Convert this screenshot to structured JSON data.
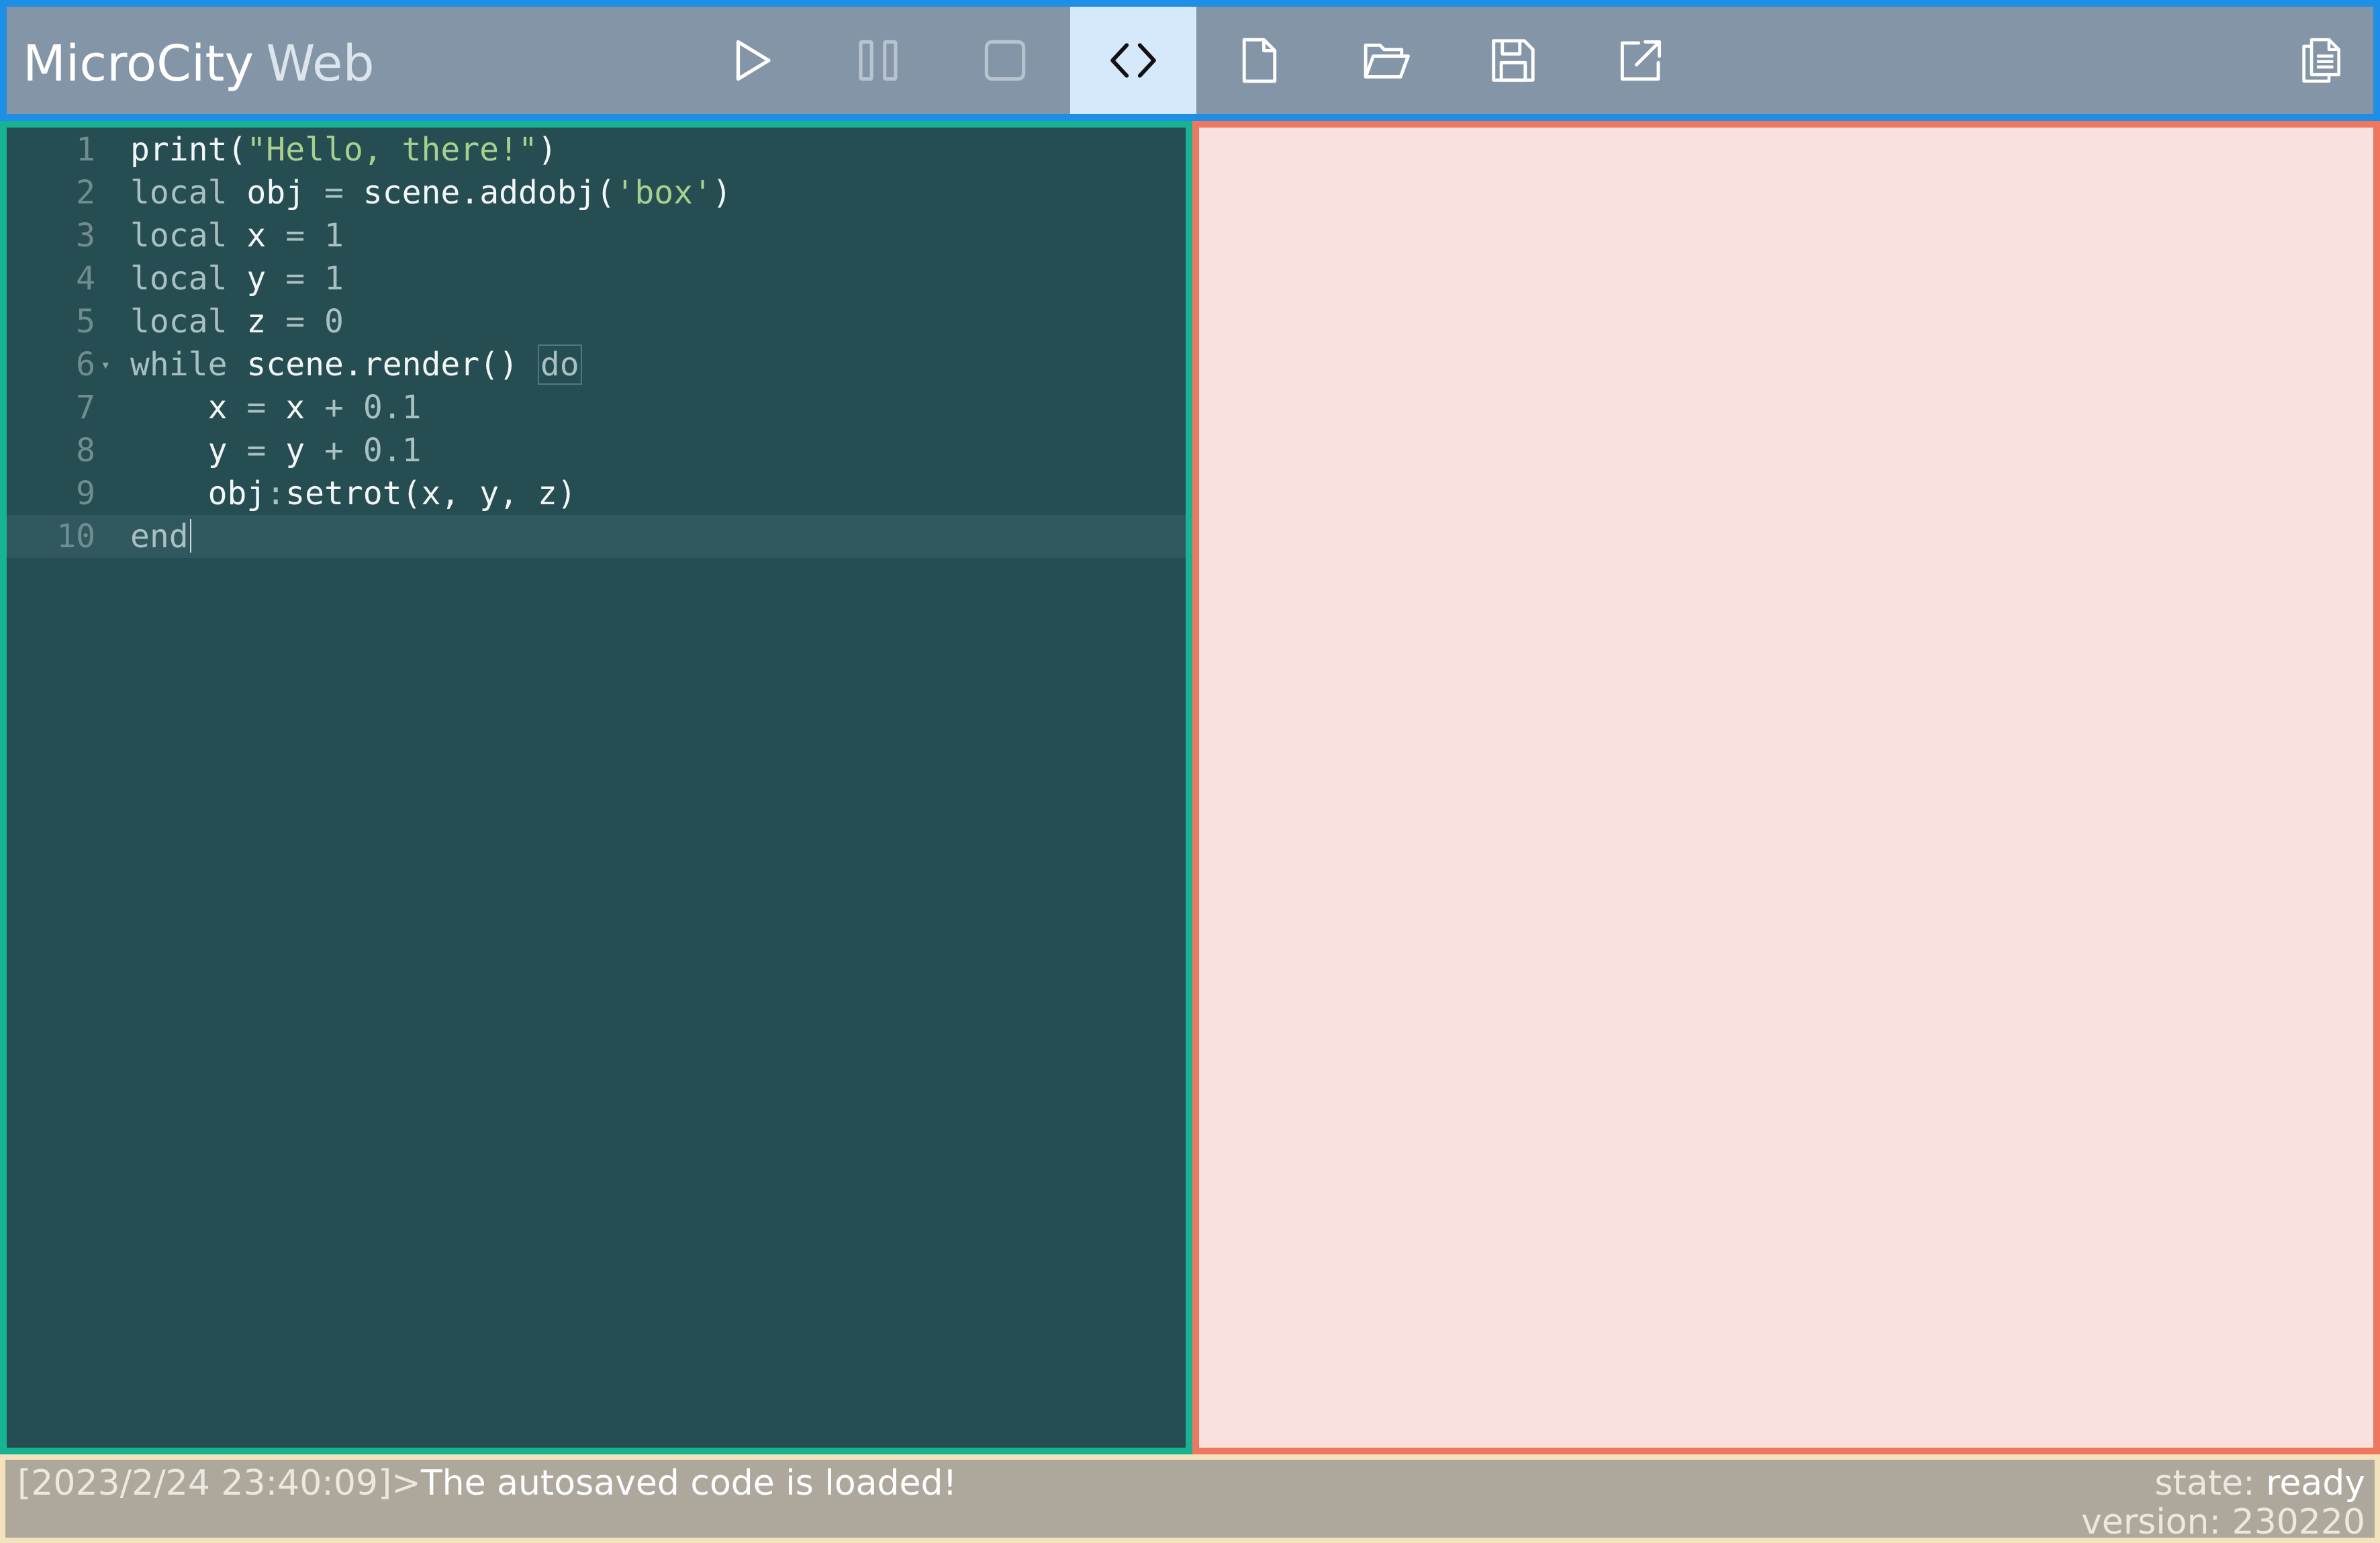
{
  "app": {
    "title_main": "MicroCity",
    "title_sub": "Web"
  },
  "toolbar": {
    "buttons": [
      {
        "name": "run",
        "icon": "play-icon",
        "active": false
      },
      {
        "name": "pause",
        "icon": "pause-icon",
        "active": false
      },
      {
        "name": "stop",
        "icon": "stop-icon",
        "active": false
      },
      {
        "name": "code",
        "icon": "code-icon",
        "active": true
      },
      {
        "name": "new-file",
        "icon": "new-file-icon",
        "active": false
      },
      {
        "name": "open-file",
        "icon": "folder-open-icon",
        "active": false
      },
      {
        "name": "save-file",
        "icon": "save-icon",
        "active": false
      },
      {
        "name": "export",
        "icon": "external-link-icon",
        "active": false
      },
      {
        "name": "copy",
        "icon": "copy-document-icon",
        "active": false
      }
    ]
  },
  "editor": {
    "current_line": 10,
    "lines": [
      {
        "n": "1",
        "tokens": [
          {
            "t": "print(",
            "c": "plain"
          },
          {
            "t": "\"Hello, there!\"",
            "c": "str"
          },
          {
            "t": ")",
            "c": "plain"
          }
        ]
      },
      {
        "n": "2",
        "tokens": [
          {
            "t": "local",
            "c": "kw"
          },
          {
            "t": " obj ",
            "c": "plain"
          },
          {
            "t": "=",
            "c": "op"
          },
          {
            "t": " scene.addobj(",
            "c": "plain"
          },
          {
            "t": "'box'",
            "c": "str"
          },
          {
            "t": ")",
            "c": "plain"
          }
        ]
      },
      {
        "n": "3",
        "tokens": [
          {
            "t": "local",
            "c": "kw"
          },
          {
            "t": " x ",
            "c": "plain"
          },
          {
            "t": "=",
            "c": "op"
          },
          {
            "t": " ",
            "c": "plain"
          },
          {
            "t": "1",
            "c": "num"
          }
        ]
      },
      {
        "n": "4",
        "tokens": [
          {
            "t": "local",
            "c": "kw"
          },
          {
            "t": " y ",
            "c": "plain"
          },
          {
            "t": "=",
            "c": "op"
          },
          {
            "t": " ",
            "c": "plain"
          },
          {
            "t": "1",
            "c": "num"
          }
        ]
      },
      {
        "n": "5",
        "tokens": [
          {
            "t": "local",
            "c": "kw"
          },
          {
            "t": " z ",
            "c": "plain"
          },
          {
            "t": "=",
            "c": "op"
          },
          {
            "t": " ",
            "c": "plain"
          },
          {
            "t": "0",
            "c": "num"
          }
        ]
      },
      {
        "n": "6",
        "fold": true,
        "tokens": [
          {
            "t": "while",
            "c": "kw"
          },
          {
            "t": " scene.render() ",
            "c": "plain"
          },
          {
            "t": "do",
            "c": "do"
          }
        ]
      },
      {
        "n": "7",
        "tokens": [
          {
            "t": "    x ",
            "c": "plain"
          },
          {
            "t": "=",
            "c": "op"
          },
          {
            "t": " x ",
            "c": "plain"
          },
          {
            "t": "+",
            "c": "op"
          },
          {
            "t": " ",
            "c": "plain"
          },
          {
            "t": "0.1",
            "c": "num"
          }
        ]
      },
      {
        "n": "8",
        "tokens": [
          {
            "t": "    y ",
            "c": "plain"
          },
          {
            "t": "=",
            "c": "op"
          },
          {
            "t": " y ",
            "c": "plain"
          },
          {
            "t": "+",
            "c": "op"
          },
          {
            "t": " ",
            "c": "plain"
          },
          {
            "t": "0.1",
            "c": "num"
          }
        ]
      },
      {
        "n": "9",
        "tokens": [
          {
            "t": "    obj",
            "c": "plain"
          },
          {
            "t": ":",
            "c": "op"
          },
          {
            "t": "setrot(x, y, z)",
            "c": "plain"
          }
        ]
      },
      {
        "n": "10",
        "tokens": [
          {
            "t": "end",
            "c": "kw"
          }
        ]
      }
    ]
  },
  "status": {
    "timestamp": "[2023/2/24 23:40:09]>",
    "message": "The autosaved code is loaded!",
    "state_label": "state:",
    "state_value": "ready",
    "version_label": "version:",
    "version_value": "230220"
  },
  "colors": {
    "toolbar_bg": "#8395a7",
    "toolbar_border": "#1f8fe6",
    "editor_bg": "#264d52",
    "editor_border": "#17b393",
    "render_bg": "#fae1dd",
    "render_border": "#ee7760",
    "status_bg": "#ada89b",
    "status_border": "#f3e2bb"
  }
}
